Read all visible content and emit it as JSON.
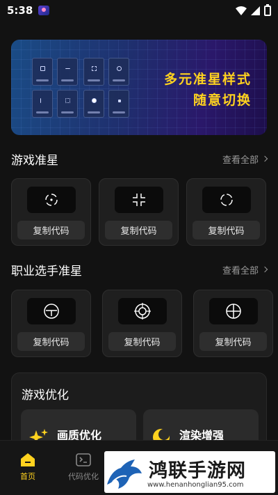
{
  "status_bar": {
    "time": "5:38"
  },
  "banner": {
    "line1": "多元准星样式",
    "line2": "随意切换"
  },
  "sections": {
    "game_crosshair": {
      "title": "游戏准星",
      "more": "查看全部"
    },
    "pro_crosshair": {
      "title": "职业选手准星",
      "more": "查看全部"
    }
  },
  "game_cards": [
    {
      "icon": "crosshair-circle-dot-icon",
      "button": "复制代码"
    },
    {
      "icon": "crosshair-corner-brackets-icon",
      "button": "复制代码"
    },
    {
      "icon": "crosshair-split-circle-icon",
      "button": "复制代码"
    }
  ],
  "pro_cards": [
    {
      "icon": "crosshair-scope-t-icon",
      "button": "复制代码"
    },
    {
      "icon": "crosshair-double-ring-icon",
      "button": "复制代码"
    },
    {
      "icon": "crosshair-circle-cross-icon",
      "button": "复制代码"
    }
  ],
  "optimization": {
    "title": "游戏优化",
    "items": [
      {
        "label": "画质优化",
        "icon": "sparkle-icon"
      },
      {
        "label": "渲染增强",
        "icon": "moon-icon"
      }
    ]
  },
  "bottom_nav": [
    {
      "label": "首页",
      "icon": "home-icon",
      "active": true
    },
    {
      "label": "代码优化",
      "icon": "terminal-icon",
      "active": false
    }
  ],
  "watermark": {
    "title": "鸿联手游网",
    "url": "www.henanhonglian95.com"
  },
  "colors": {
    "accent": "#ffd21f",
    "background": "#121212",
    "card": "#1f1f1f"
  }
}
